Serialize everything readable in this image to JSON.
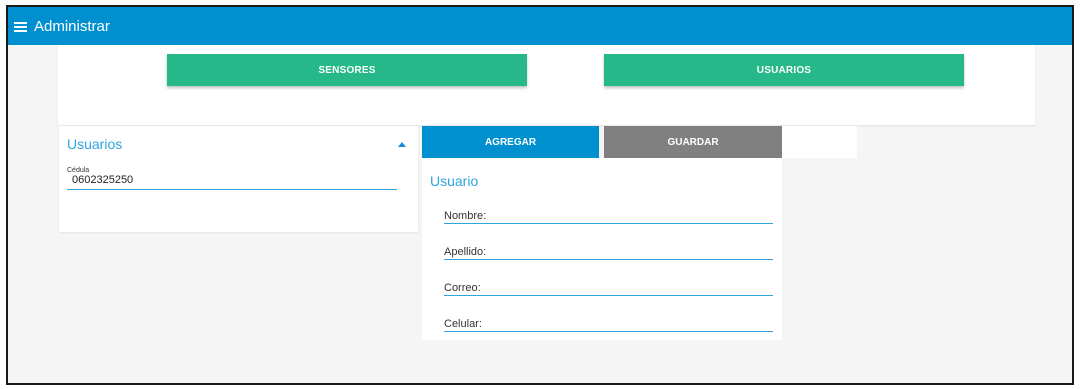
{
  "header": {
    "title": "Administrar",
    "menu_icon": "hamburger-menu-icon"
  },
  "nav_buttons": {
    "sensores": "SENSORES",
    "usuarios": "USUARIOS"
  },
  "users_panel": {
    "title": "Usuarios",
    "cedula_label": "Cédula",
    "cedula_value": "0602325250"
  },
  "actions": {
    "agregar": "AGREGAR",
    "guardar": "GUARDAR"
  },
  "user_form": {
    "title": "Usuario",
    "fields": [
      "Nombre:",
      "Apellido:",
      "Correo:",
      "Celular:"
    ]
  },
  "colors": {
    "appbar": "#0090d0",
    "green": "#26b888",
    "grey": "#808080",
    "accent": "#2ea4e0"
  }
}
